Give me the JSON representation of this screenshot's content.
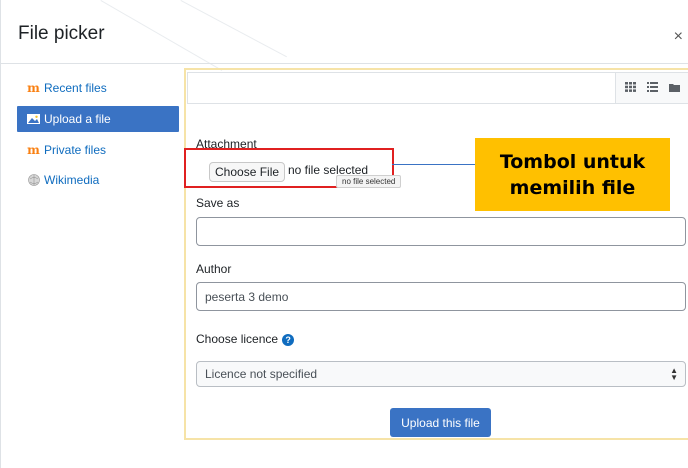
{
  "dialog": {
    "title": "File picker",
    "close_glyph": "×"
  },
  "sidebar": {
    "items": [
      {
        "label": "Recent files",
        "icon": "moodle-icon",
        "active": false
      },
      {
        "label": "Upload a file",
        "icon": "upload-icon",
        "active": true
      },
      {
        "label": "Private files",
        "icon": "moodle-icon",
        "active": false
      },
      {
        "label": "Wikimedia",
        "icon": "globe-icon",
        "active": false
      }
    ]
  },
  "toolbar": {
    "view_icons": [
      "grid-view-icon",
      "list-view-icon",
      "folder-view-icon"
    ]
  },
  "form": {
    "attachment_label": "Attachment",
    "choose_file_label": "Choose File",
    "no_file_text": "no file selected",
    "tooltip_text": "no file selected",
    "save_as_label": "Save as",
    "save_as_value": "",
    "author_label": "Author",
    "author_value": "peserta 3 demo",
    "licence_label": "Choose licence",
    "licence_value": "Licence not specified",
    "upload_button_label": "Upload this file"
  },
  "annotation": {
    "line1": "Tombol untuk",
    "line2": "memilih file",
    "color": "#ffc000",
    "connector_color": "#3a73c4",
    "highlight_color": "#e02020"
  }
}
